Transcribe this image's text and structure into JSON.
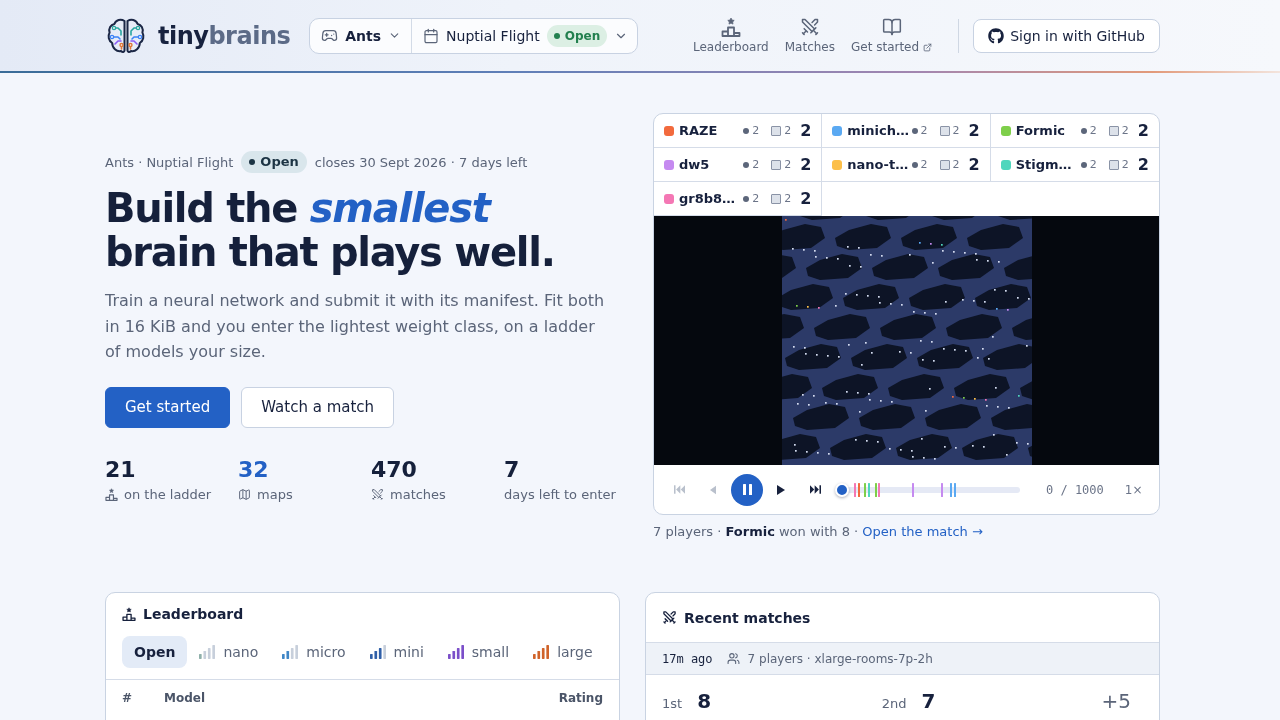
{
  "header": {
    "brand": [
      "tiny",
      "brains"
    ],
    "game_selector": {
      "label": "Ants"
    },
    "season_selector": {
      "label": "Nuptial Flight",
      "status": "Open"
    },
    "nav": [
      {
        "label": "Leaderboard",
        "external": false
      },
      {
        "label": "Matches",
        "external": false
      },
      {
        "label": "Get started",
        "external": true
      }
    ],
    "sign_in_button": "Sign in with GitHub"
  },
  "hero": {
    "breadcrumb": "Ants · Nuptial Flight",
    "status": "Open",
    "closing": "closes 30 Sept 2026 · 7 days left",
    "headline": "Build the *smallest* brain that plays well.",
    "description": "Train a neural network and submit it with its manifest. Fit both in 16 KiB and you enter the lightest weight class, on a ladder of models your size.",
    "buttons": [
      {
        "label": "Get started",
        "kind": "primary"
      },
      {
        "label": "Watch a match",
        "kind": "secondary"
      }
    ],
    "stats": [
      {
        "value": "21",
        "label": "on the ladder",
        "highlighted": false
      },
      {
        "value": "32",
        "label": "maps",
        "highlighted": true
      },
      {
        "value": "470",
        "label": "matches",
        "highlighted": false
      },
      {
        "value": "7",
        "label": "days left to enter",
        "highlighted": false
      }
    ]
  },
  "match_preview": {
    "players": [
      {
        "name": "RAZE",
        "color": "#f26a3d",
        "circle_count": "2",
        "square_count": "2",
        "score": "2"
      },
      {
        "name": "minich…",
        "color": "#5aa9f2",
        "circle_count": "2",
        "square_count": "2",
        "score": "2"
      },
      {
        "name": "Formic",
        "color": "#7ecf4a",
        "circle_count": "2",
        "square_count": "2",
        "score": "2"
      },
      {
        "name": "dw5",
        "color": "#c58af0",
        "circle_count": "2",
        "square_count": "2",
        "score": "2"
      },
      {
        "name": "nano-t…",
        "color": "#fcbf49",
        "circle_count": "2",
        "square_count": "2",
        "score": "2"
      },
      {
        "name": "Stigm…",
        "color": "#4fd6bd",
        "circle_count": "2",
        "square_count": "2",
        "score": "2"
      },
      {
        "name": "gr8b8…",
        "color": "#f477b4",
        "circle_count": "2",
        "square_count": "2",
        "score": "2"
      }
    ],
    "replay": {
      "controls": [
        {
          "kind": "skip_to_start",
          "disabled": true
        },
        {
          "kind": "step_back",
          "disabled": true
        },
        {
          "kind": "play_pause",
          "playing": true
        },
        {
          "kind": "step_forward",
          "disabled": false
        },
        {
          "kind": "skip_to_end",
          "disabled": false
        }
      ],
      "timeline": {
        "level": 0
      },
      "counter": "0 / 1000",
      "speed": "1×"
    },
    "summary": "7 players · **Formic** won with 8 ·",
    "link": "Open the match →"
  },
  "leaderboard": {
    "title": "Leaderboard",
    "tabs": [
      {
        "label": "Open",
        "selected": true
      },
      {
        "label": "nano",
        "selected": false,
        "color": "#8fb0aa"
      },
      {
        "label": "micro",
        "selected": false,
        "color": "#3f86c6"
      },
      {
        "label": "mini",
        "selected": false,
        "color": "#2f5fa8"
      },
      {
        "label": "small",
        "selected": false,
        "color": "#7b4fc9"
      },
      {
        "label": "large",
        "selected": false,
        "color": "#d0632a"
      }
    ],
    "columns": [
      "#",
      "Model",
      "Rating"
    ]
  },
  "recent_matches": {
    "title": "Recent matches",
    "matches": [
      {
        "age": "17m ago",
        "details": "7 players · xlarge-rooms-7p-2h",
        "placings": [
          {
            "place": "1st",
            "score": "8"
          },
          {
            "place": "2nd",
            "score": "7"
          }
        ],
        "margin": "+5"
      }
    ]
  }
}
